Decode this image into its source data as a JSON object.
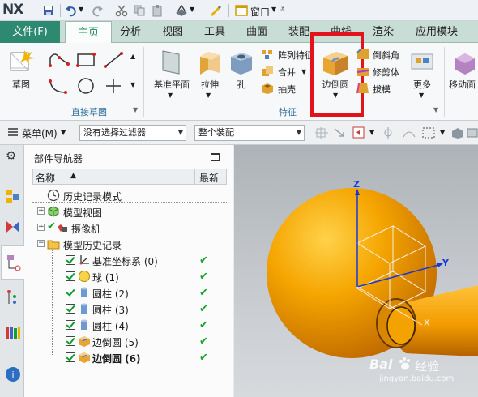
{
  "app": {
    "logo": "NX",
    "window_menu": "窗口"
  },
  "tabs": {
    "file": "文件(F)",
    "items": [
      "主页",
      "分析",
      "视图",
      "工具",
      "曲面",
      "装配",
      "曲线",
      "渲染",
      "应用模块"
    ]
  },
  "ribbon": {
    "sketch": "草图",
    "direct_sketch_group": "直接草图",
    "datum_plane": "基准平面",
    "extrude": "拉伸",
    "hole": "孔",
    "pattern_feature": "阵列特征",
    "unite": "合并",
    "shell": "抽壳",
    "feature_group": "特征",
    "edge_blend": "边倒圆",
    "chamfer": "倒斜角",
    "trim_body": "修剪体",
    "draft": "拔模",
    "more": "更多",
    "move_face": "移动面"
  },
  "toolbar": {
    "menu": "菜单(M)",
    "filter": "没有选择过滤器",
    "assembly": "整个装配"
  },
  "navigator": {
    "title": "部件导航器",
    "col_name": "名称",
    "col_latest": "最新",
    "nodes": [
      {
        "label": "历史记录模式"
      },
      {
        "label": "模型视图"
      },
      {
        "label": "摄像机"
      },
      {
        "label": "模型历史记录"
      }
    ],
    "features": [
      {
        "label": "基准坐标系 (0)"
      },
      {
        "label": "球 (1)"
      },
      {
        "label": "圆柱 (2)"
      },
      {
        "label": "圆柱 (3)"
      },
      {
        "label": "圆柱 (4)"
      },
      {
        "label": "边倒圆 (5)"
      },
      {
        "label": "边倒圆 (6)"
      }
    ],
    "latest_mark": "✔"
  },
  "viewport": {
    "axis_z": "Z",
    "axis_y": "Y",
    "axis_x": "X"
  },
  "watermark": {
    "brand": "Bai",
    "brand2": "经验",
    "url": "jingyan.baidu.com"
  },
  "colors": {
    "accent": "#2d8a70",
    "highlight": "#e3131b",
    "model": "#f5a500"
  }
}
